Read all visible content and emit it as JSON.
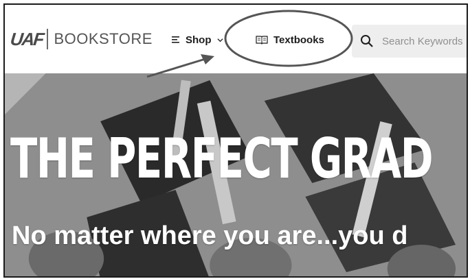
{
  "logo": {
    "mark": "UAF",
    "text": "BOOKSTORE"
  },
  "nav": {
    "shop_label": "Shop",
    "textbooks_label": "Textbooks"
  },
  "search": {
    "placeholder": "Search Keywords"
  },
  "hero": {
    "title": "THE PERFECT GRAD",
    "subtitle": "No matter where you are...you d"
  },
  "icons": {
    "shop": "menu-lines-icon",
    "shop_caret": "chevron-down-icon",
    "textbooks": "open-book-icon",
    "search": "search-icon"
  },
  "colors": {
    "annotation": "#555555",
    "text_dark": "#1c1c1c",
    "search_bg": "#eeeeee"
  }
}
